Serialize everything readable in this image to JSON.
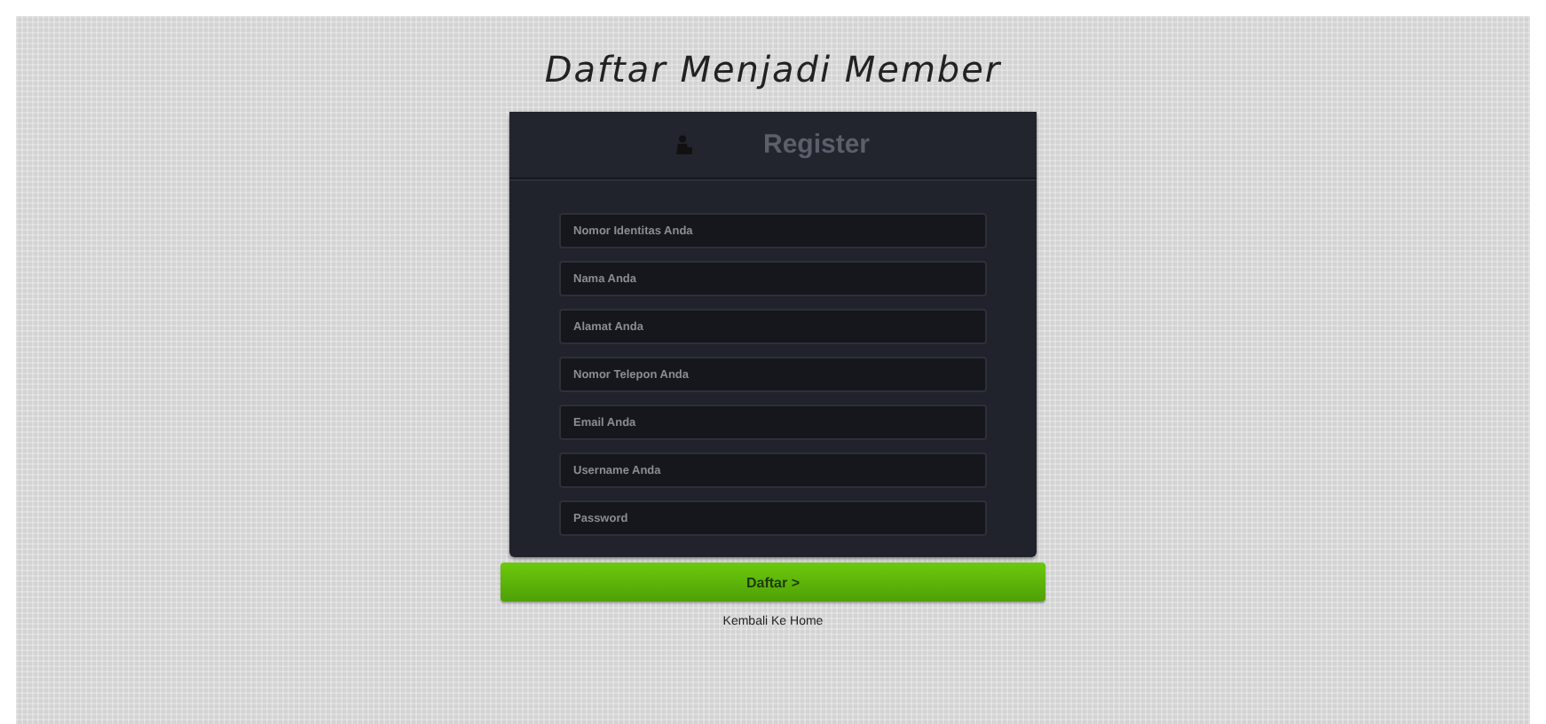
{
  "page_title": "Daftar Menjadi Member",
  "panel": {
    "title": "Register"
  },
  "fields": [
    {
      "placeholder": "Nomor Identitas Anda"
    },
    {
      "placeholder": "Nama Anda"
    },
    {
      "placeholder": "Alamat Anda"
    },
    {
      "placeholder": "Nomor Telepon Anda"
    },
    {
      "placeholder": "Email Anda"
    },
    {
      "placeholder": "Username Anda"
    },
    {
      "placeholder": "Password"
    }
  ],
  "submit_button": "Daftar >",
  "home_link": "Kembali Ke Home"
}
